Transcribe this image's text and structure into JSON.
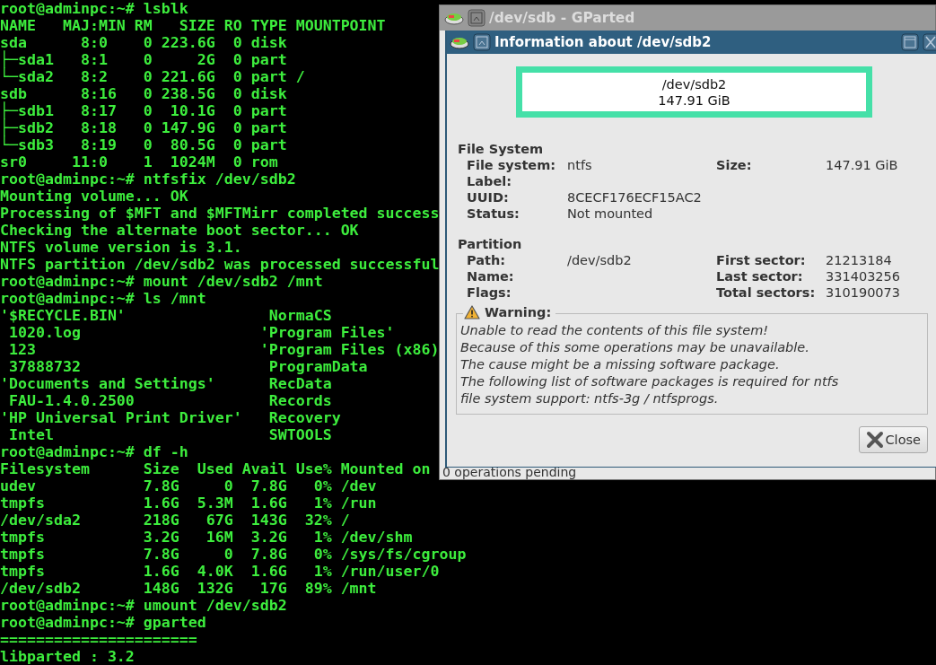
{
  "terminal": {
    "lines": [
      "root@adminpc:~# lsblk",
      "NAME   MAJ:MIN RM   SIZE RO TYPE MOUNTPOINT",
      "sda      8:0    0 223.6G  0 disk",
      "├─sda1   8:1    0     2G  0 part",
      "└─sda2   8:2    0 221.6G  0 part /",
      "sdb      8:16   0 238.5G  0 disk",
      "├─sdb1   8:17   0  10.1G  0 part",
      "├─sdb2   8:18   0 147.9G  0 part",
      "└─sdb3   8:19   0  80.5G  0 part",
      "sr0     11:0    1  1024M  0 rom",
      "root@adminpc:~# ntfsfix /dev/sdb2",
      "Mounting volume... OK",
      "Processing of $MFT and $MFTMirr completed success",
      "Checking the alternate boot sector... OK",
      "NTFS volume version is 3.1.",
      "NTFS partition /dev/sdb2 was processed successful",
      "root@adminpc:~# mount /dev/sdb2 /mnt",
      "root@adminpc:~# ls /mnt",
      "'$RECYCLE.BIN'                NormaCS",
      " 1020.log                    'Program Files'",
      " 123                         'Program Files (x86)",
      " 37888732                     ProgramData",
      "'Documents and Settings'      RecData",
      " FAU-1.4.0.2500               Records",
      "'HP Universal Print Driver'   Recovery",
      " Intel                        SWTOOLS",
      "root@adminpc:~# df -h",
      "Filesystem      Size  Used Avail Use% Mounted on",
      "udev            7.8G     0  7.8G   0% /dev",
      "tmpfs           1.6G  5.3M  1.6G   1% /run",
      "/dev/sda2       218G   67G  143G  32% /",
      "tmpfs           3.2G   16M  3.2G   1% /dev/shm",
      "tmpfs           7.8G     0  7.8G   0% /sys/fs/cgroup",
      "tmpfs           1.6G  4.0K  1.6G   1% /run/user/0",
      "/dev/sdb2       148G  132G   17G  89% /mnt",
      "root@adminpc:~# umount /dev/sdb2",
      "root@adminpc:~# gparted",
      "======================",
      "libparted : 3.2"
    ]
  },
  "gparted_window": {
    "title": "/dev/sdb - GParted",
    "status_bar": "0 operations pending"
  },
  "dialog": {
    "title": "Information about /dev/sdb2",
    "partition_graphic": {
      "path": "/dev/sdb2",
      "size": "147.91 GiB"
    },
    "sections": [
      {
        "heading": "File System",
        "rows": [
          {
            "label": "File system:",
            "value": "ntfs",
            "label_2": "Size:",
            "value_2": "147.91 GiB"
          },
          {
            "label": "Label:"
          },
          {
            "label": "UUID:",
            "value": "8CECF176ECF15AC2"
          },
          {
            "label": "Status:",
            "value": "Not mounted"
          }
        ]
      },
      {
        "heading": "Partition",
        "rows": [
          {
            "label": "Path:",
            "value": "/dev/sdb2",
            "label_2": "First sector:",
            "value_2": "21213184"
          },
          {
            "label": "Name:",
            "label_2": "Last sector:",
            "value_2": "331403256"
          },
          {
            "label": "Flags:",
            "label_2": "Total sectors:",
            "value_2": "310190073"
          }
        ]
      }
    ],
    "warning": {
      "title": "Warning:",
      "lines": [
        "Unable to read the contents of this file system!",
        "Because of this some operations may be unavailable.",
        "The cause might be a missing software package.",
        "The following list of software packages is required for ntfs",
        "file system support:  ntfs-3g / ntfsprogs."
      ]
    },
    "buttons": [
      {
        "label": "Close"
      }
    ]
  }
}
